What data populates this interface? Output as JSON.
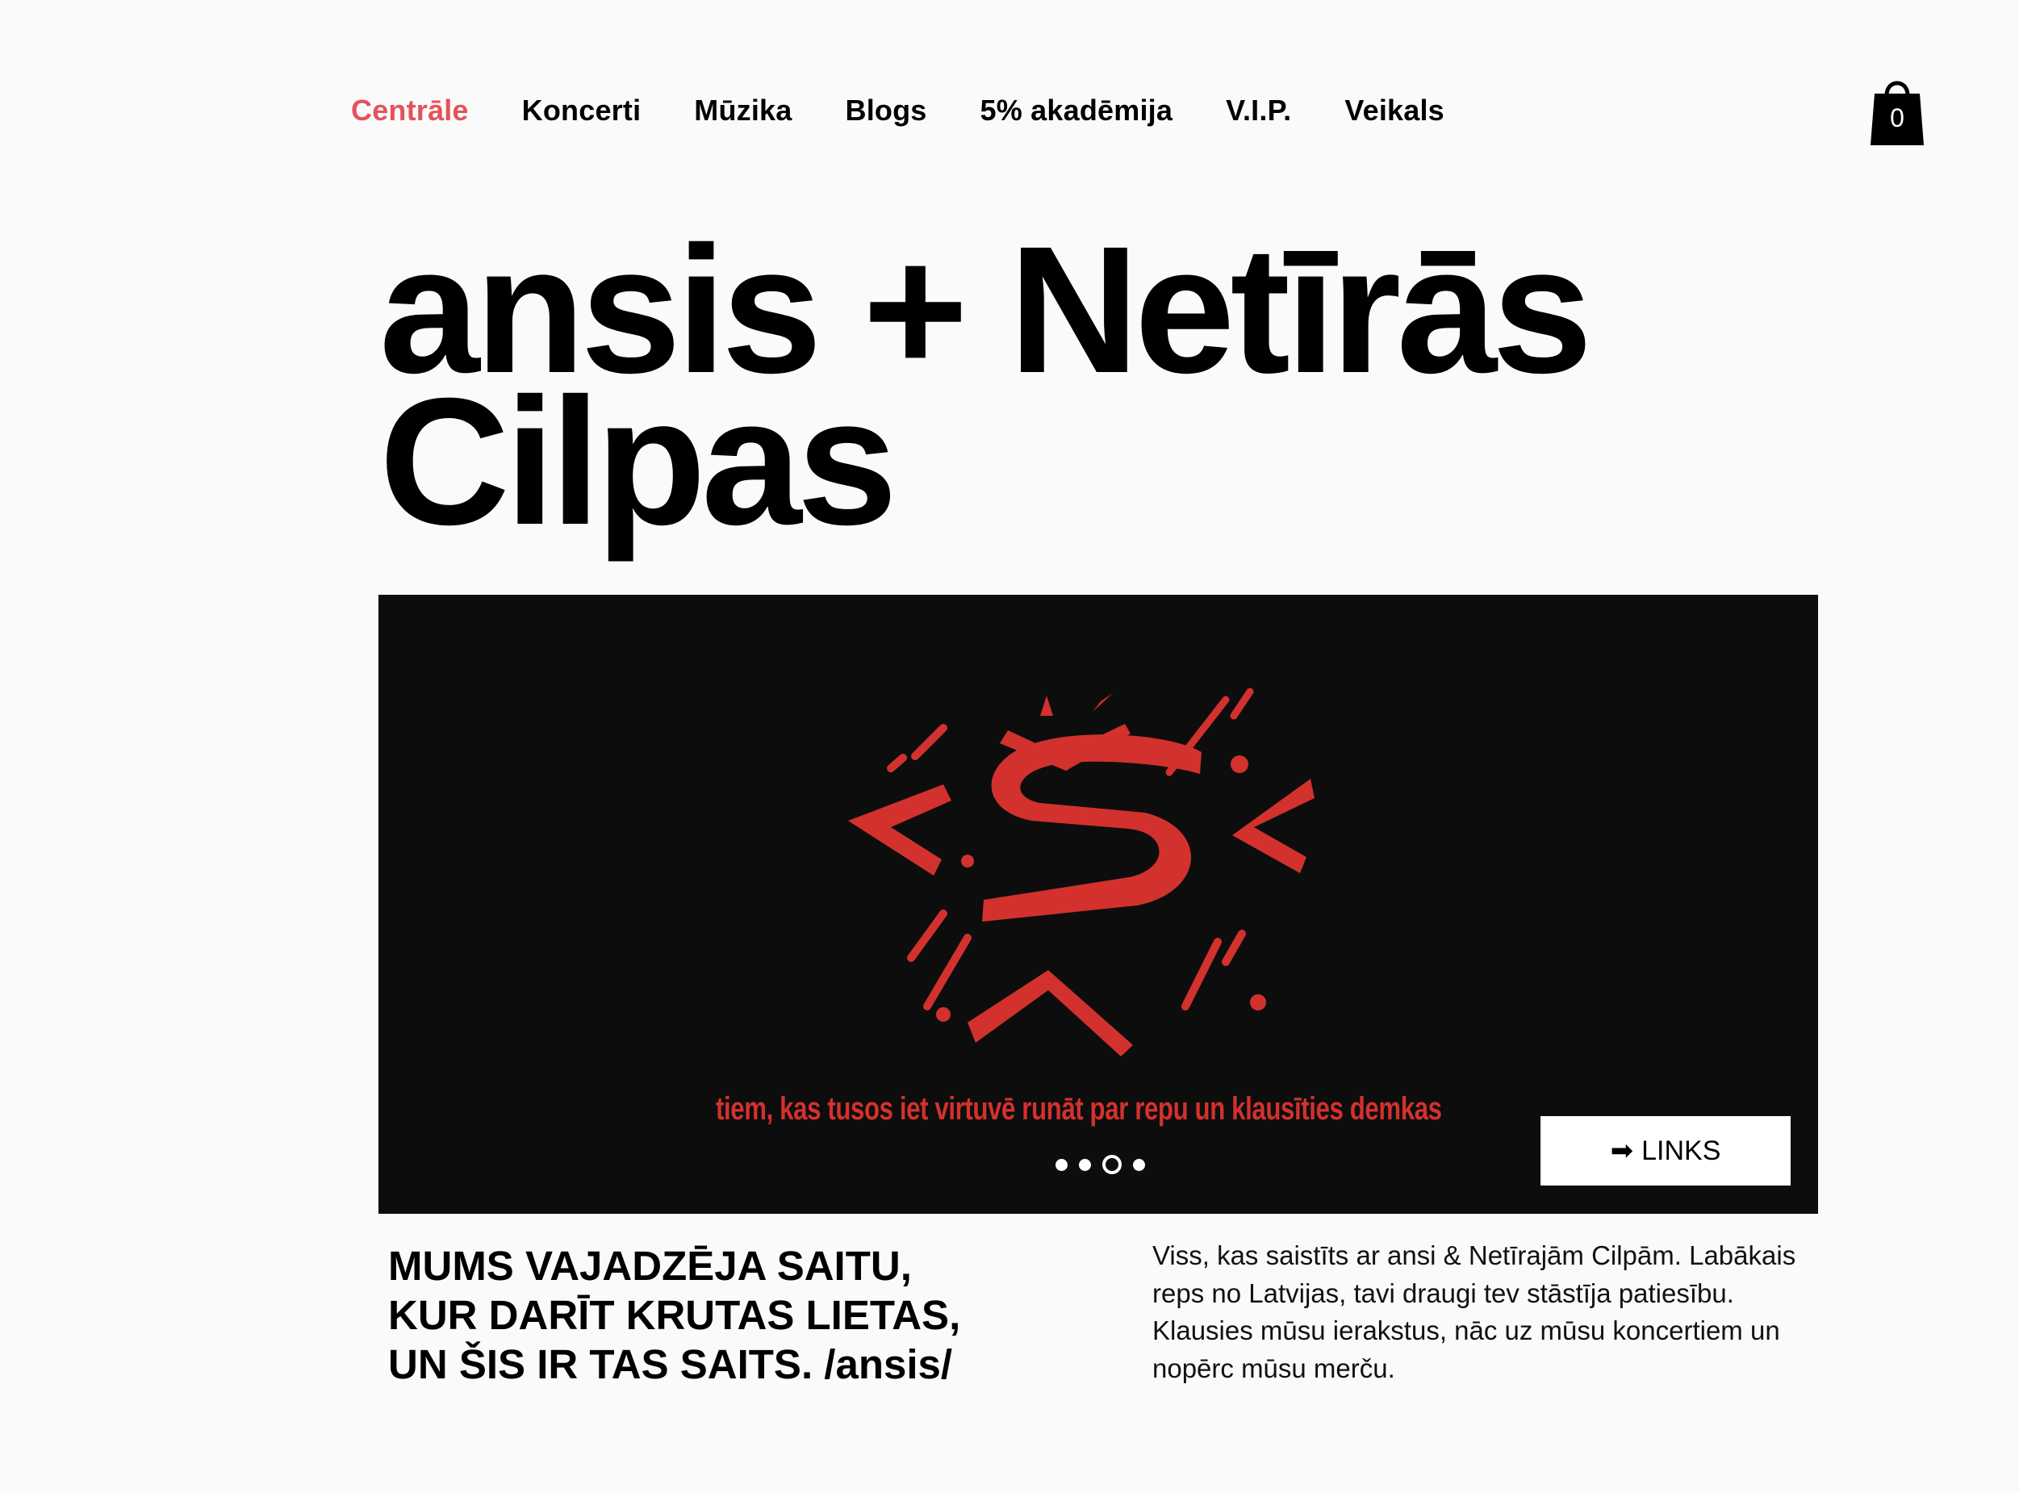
{
  "nav": {
    "items": [
      {
        "label": "Centrāle",
        "active": true
      },
      {
        "label": "Koncerti",
        "active": false
      },
      {
        "label": "Mūzika",
        "active": false
      },
      {
        "label": "Blogs",
        "active": false
      },
      {
        "label": "5% akadēmija",
        "active": false
      },
      {
        "label": "V.I.P.",
        "active": false
      },
      {
        "label": "Veikals",
        "active": false
      }
    ],
    "active_color": "#e4535b"
  },
  "cart": {
    "icon": "shopping-bag-icon",
    "count": "0"
  },
  "hero": {
    "title_line1": "ansis + Netīrās",
    "title_line2": "Cilpas"
  },
  "banner": {
    "background": "#0d0d0d",
    "logo_icon": "ansis-red-brush-logo",
    "logo_color": "#d3312d",
    "tagline": "tiem, kas tusos iet virtuvē runāt par repu un klausīties demkas",
    "slides": {
      "total": 4,
      "active_index": 2
    },
    "links_button": {
      "icon": "arrow-right-icon",
      "arrow": "➡",
      "label": "LINKS"
    }
  },
  "slogan": {
    "lines": [
      "MUMS VAJADZĒJA SAITU,",
      "KUR DARĪT KRUTAS LIETAS,",
      "UN ŠIS IR TAS SAITS. /ansis/"
    ]
  },
  "description": {
    "lines": [
      "Viss, kas saistīts ar ansi & Netīrajām Cilpām. Labākais",
      "reps no Latvijas, tavi draugi tev stāstīja patiesību.",
      "Klausies mūsu ierakstus, nāc uz mūsu koncertiem un",
      "nopērc mūsu merču."
    ]
  }
}
